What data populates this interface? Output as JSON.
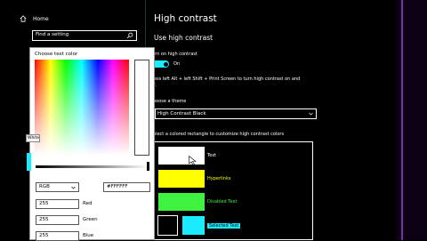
{
  "left_pane": {
    "home_label": "Home",
    "search_placeholder": "Find a setting"
  },
  "main": {
    "title": "High contrast",
    "section_title": "Use high contrast",
    "toggle_label": "urn on high contrast",
    "toggle_state": "On",
    "shortcut_line1": "ress left Alt + left Shift + Print Screen to turn high contrast on and",
    "shortcut_line2": "ff.",
    "theme_label": "hoose a theme",
    "theme_value": "High Contrast Black",
    "swatch_instruction": "elect a colored rectangle to customize high contrast colors",
    "swatches": [
      {
        "label": "Text",
        "color": "#ffffff",
        "label_color": "#ffffff"
      },
      {
        "label": "Hyperlinks",
        "color": "#ffff00",
        "label_color": "#ffff00"
      },
      {
        "label": "Disabled Text",
        "color": "#3ff23f",
        "label_color": "#3ff23f"
      },
      {
        "label": "Selected Text",
        "color": "#1aebff",
        "label_color": "#000000"
      }
    ]
  },
  "picker": {
    "title": "Choose text color",
    "tooltip": "White",
    "mode": "RGB",
    "hex": "#FFFFFF",
    "red_value": "255",
    "red_label": "Red",
    "green_value": "255",
    "green_label": "Green",
    "blue_value": "255",
    "blue_label": "Blue"
  },
  "colors": {
    "accent": "#1aebff",
    "window_edge": "#7a2fa8"
  }
}
